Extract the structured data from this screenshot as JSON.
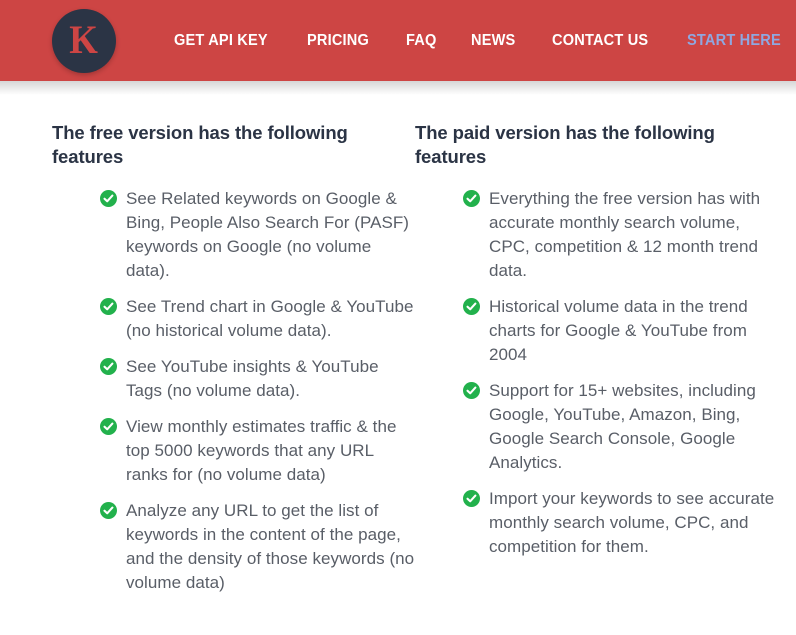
{
  "header": {
    "background_color": "#cd4544",
    "logo": {
      "icon": "logo-circle-k",
      "letter": "K",
      "circle_color": "#2b3445",
      "letter_color": "#cd4544"
    },
    "nav": [
      {
        "label": "GET API KEY",
        "accent": false
      },
      {
        "label": "PRICING",
        "accent": false
      },
      {
        "label": "FAQ",
        "accent": false
      },
      {
        "label": "NEWS",
        "accent": false
      },
      {
        "label": "CONTACT US",
        "accent": false
      },
      {
        "label": "START HERE",
        "accent": true
      }
    ],
    "accent_color": "#8fa7e0"
  },
  "columns": {
    "free": {
      "heading": "The free version has the following features",
      "bullet_icon": "check-circle-icon",
      "bullet_color": "#22b14c",
      "items": [
        "See Related keywords on Google & Bing, People Also Search For (PASF) keywords on Google (no volume data).",
        "See Trend chart in Google & YouTube (no historical volume data).",
        "See YouTube insights & YouTube Tags (no volume data).",
        "View monthly estimates traffic & the top 5000 keywords that any URL ranks for (no volume data)",
        "Analyze any URL to get the list of keywords in the content of the page, and the density of those keywords (no volume data)"
      ]
    },
    "paid": {
      "heading": "The paid version has the following features",
      "bullet_icon": "check-circle-icon",
      "bullet_color": "#22b14c",
      "items": [
        "Everything the free version has with accurate monthly search volume, CPC, competition & 12 month trend data.",
        "Historical volume data in the trend charts for Google & YouTube from 2004",
        "Support for 15+ websites, including Google, YouTube, Amazon, Bing, Google Search Console, Google Analytics.",
        "Import your keywords to see accurate monthly search volume, CPC, and competition for them."
      ]
    }
  }
}
